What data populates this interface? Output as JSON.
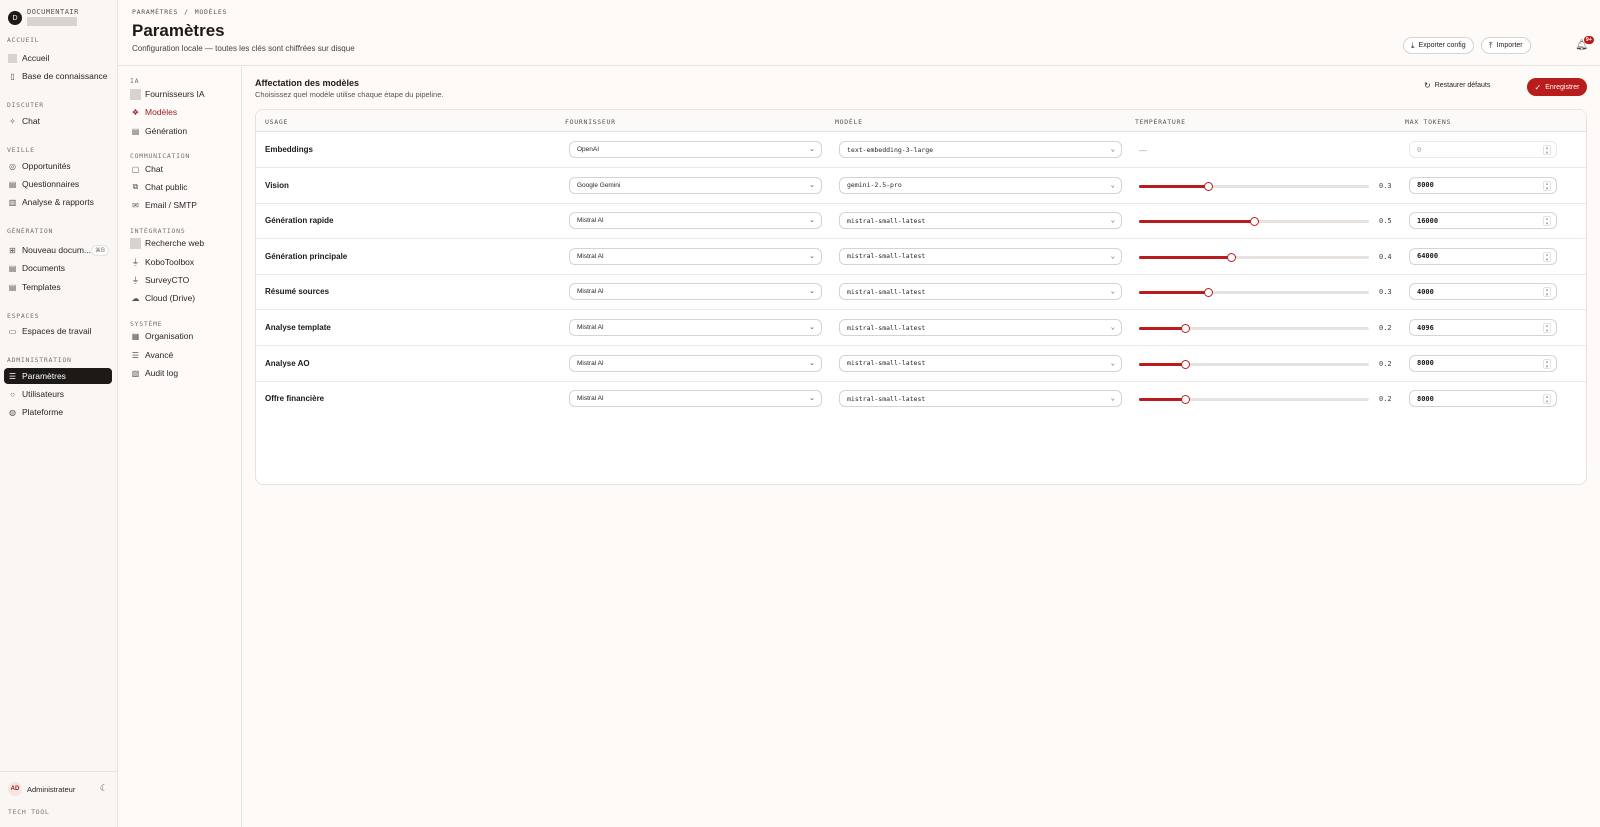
{
  "app": {
    "brand": "DOCUMENTAIR",
    "logo_glyph": "D"
  },
  "sidebar": {
    "sections": [
      {
        "label": "ACCUEIL",
        "items": [
          {
            "label": "Accueil",
            "icon": "placeholder-icon"
          },
          {
            "label": "Base de connaissance",
            "icon": "book-icon"
          }
        ]
      },
      {
        "label": "DISCUTER",
        "items": [
          {
            "label": "Chat",
            "icon": "sparkle-icon"
          }
        ]
      },
      {
        "label": "VEILLE",
        "items": [
          {
            "label": "Opportunités",
            "icon": "radar-icon"
          },
          {
            "label": "Questionnaires",
            "icon": "file-icon"
          },
          {
            "label": "Analyse & rapports",
            "icon": "chart-icon"
          }
        ]
      },
      {
        "label": "GÉNÉRATION",
        "items": [
          {
            "label": "Nouveau docum...",
            "icon": "file-plus-icon",
            "kbd": "⌘B"
          },
          {
            "label": "Documents",
            "icon": "file-icon"
          },
          {
            "label": "Templates",
            "icon": "file-icon"
          }
        ]
      },
      {
        "label": "ESPACES",
        "items": [
          {
            "label": "Espaces de travail",
            "icon": "folder-icon"
          }
        ]
      },
      {
        "label": "ADMINISTRATION",
        "items": [
          {
            "label": "Paramètres",
            "icon": "sliders-icon",
            "active": true
          },
          {
            "label": "Utilisateurs",
            "icon": "user-icon"
          },
          {
            "label": "Plateforme",
            "icon": "globe-icon"
          }
        ]
      }
    ],
    "user": {
      "initials": "AD",
      "name": "Administrateur"
    },
    "footer_label": "TECH TOOL"
  },
  "header": {
    "breadcrumb": [
      "PARAMÈTRES",
      "/",
      "MODÈLES"
    ],
    "title": "Paramètres",
    "subtitle": "Configuration locale — toutes les clés sont chiffrées sur disque",
    "export_label": "Exporter config",
    "import_label": "Importer",
    "notif_count": "9+"
  },
  "subnav": {
    "sections": [
      {
        "label": "IA",
        "items": [
          {
            "label": "Fournisseurs IA",
            "icon": "placeholder-icon"
          },
          {
            "label": "Modèles",
            "icon": "cubes-icon",
            "active": true
          },
          {
            "label": "Génération",
            "icon": "file-icon"
          }
        ]
      },
      {
        "label": "COMMUNICATION",
        "items": [
          {
            "label": "Chat",
            "icon": "message-icon"
          },
          {
            "label": "Chat public",
            "icon": "messages-icon"
          },
          {
            "label": "Email / SMTP",
            "icon": "mail-icon"
          }
        ]
      },
      {
        "label": "INTÉGRATIONS",
        "items": [
          {
            "label": "Recherche web",
            "icon": "placeholder-icon"
          },
          {
            "label": "KoboToolbox",
            "icon": "plug-icon"
          },
          {
            "label": "SurveyCTO",
            "icon": "plug-icon"
          },
          {
            "label": "Cloud (Drive)",
            "icon": "cloud-icon"
          }
        ]
      },
      {
        "label": "SYSTÈME",
        "items": [
          {
            "label": "Organisation",
            "icon": "building-icon"
          },
          {
            "label": "Avancé",
            "icon": "sliders-icon"
          },
          {
            "label": "Audit log",
            "icon": "scroll-icon"
          }
        ]
      }
    ]
  },
  "main": {
    "title": "Affectation des modèles",
    "subtitle": "Choisissez quel modèle utilise chaque étape du pipeline.",
    "restore_label": "Restaurer défauts",
    "save_label": "Enregistrer",
    "columns": [
      "USAGE",
      "FOURNISSEUR",
      "MODÈLE",
      "TEMPÉRATURE",
      "MAX TOKENS"
    ],
    "rows": [
      {
        "usage": "Embeddings",
        "provider": "OpenAI",
        "model": "text-embedding-3-large",
        "temperature": null,
        "temperature_label": "—",
        "max_tokens": "0",
        "disabled": true
      },
      {
        "usage": "Vision",
        "provider": "Google Gemini",
        "model": "gemini-2.5-pro",
        "temperature": 0.3,
        "temperature_label": "0.3",
        "max_tokens": "8000"
      },
      {
        "usage": "Génération rapide",
        "provider": "Mistral AI",
        "model": "mistral-small-latest",
        "temperature": 0.5,
        "temperature_label": "0.5",
        "max_tokens": "16000"
      },
      {
        "usage": "Génération principale",
        "provider": "Mistral AI",
        "model": "mistral-small-latest",
        "temperature": 0.4,
        "temperature_label": "0.4",
        "max_tokens": "64000"
      },
      {
        "usage": "Résumé sources",
        "provider": "Mistral AI",
        "model": "mistral-small-latest",
        "temperature": 0.3,
        "temperature_label": "0.3",
        "max_tokens": "4000"
      },
      {
        "usage": "Analyse template",
        "provider": "Mistral AI",
        "model": "mistral-small-latest",
        "temperature": 0.2,
        "temperature_label": "0.2",
        "max_tokens": "4096"
      },
      {
        "usage": "Analyse AO",
        "provider": "Mistral AI",
        "model": "mistral-small-latest",
        "temperature": 0.2,
        "temperature_label": "0.2",
        "max_tokens": "8000"
      },
      {
        "usage": "Offre financière",
        "provider": "Mistral AI",
        "model": "mistral-small-latest",
        "temperature": 0.2,
        "temperature_label": "0.2",
        "max_tokens": "8000"
      }
    ]
  },
  "colors": {
    "accent": "#b91c1c",
    "active_nav_bg": "#1c1917"
  }
}
